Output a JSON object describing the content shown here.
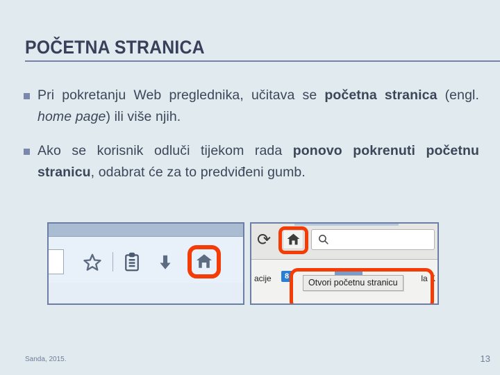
{
  "slide": {
    "title": "POČETNA STRANICA",
    "bullets": [
      {
        "marker": "square-bullet",
        "segments": [
          {
            "text": "Pri pokretanju Web preglednika, učitava se ",
            "style": "normal"
          },
          {
            "text": "početna stranica",
            "style": "bold"
          },
          {
            "text": " (engl. ",
            "style": "normal"
          },
          {
            "text": "home page",
            "style": "italic"
          },
          {
            "text": ") ili više njih.",
            "style": "normal"
          }
        ],
        "plain": "Pri pokretanju Web preglednika, učitava se početna stranica (engl. home page) ili više njih.",
        "line1": "Pri pokretanju Web preglednika, učitava se",
        "line2_bold": "početna stranica",
        "line2_rest_a": " (engl. ",
        "line2_italic": "home page",
        "line2_rest_b": ") ili više njih."
      },
      {
        "marker": "square-bullet",
        "plain": "Ako se korisnik odluči tijekom rada ponovo pokrenuti početnu stranicu, odabrat će za to predviđeni gumb.",
        "line1_normal": "Ako se korisnik odluči tijekom rada ",
        "line1_bold": "ponovo",
        "line2_bold": "pokrenuti početnu stranicu",
        "line2_rest": ", odabrat će za to",
        "line3": "predviđeni gumb."
      }
    ]
  },
  "figure_left": {
    "name": "browser-toolbar-screenshot",
    "icons": [
      "address-bar-end",
      "star-icon",
      "clipboard-list-icon",
      "down-arrow-icon",
      "home-icon"
    ],
    "highlight_color": "#f33c06",
    "highlighted_icon": "home-icon"
  },
  "figure_right": {
    "name": "browser-home-button-tooltip-screenshot",
    "reload_glyph": "⟳",
    "tooltip_text": "Otvori početnu stranicu",
    "bookmark_text_left": "acije",
    "bookmark_favicon_text": "8",
    "bookmark_text_right": "la K",
    "highlight_color": "#f33c06",
    "highlighted_items": [
      "home-icon",
      "tooltip"
    ]
  },
  "footer": {
    "credit": "Sanda, 2015.",
    "page_number": "13"
  },
  "theme": {
    "background": "#e1eaef",
    "title_color": "#39405a",
    "rule_color": "#7781a8",
    "bullet_color": "#7b88ad",
    "body_text_color": "#3c4659",
    "footer_color": "#6f7d99"
  }
}
